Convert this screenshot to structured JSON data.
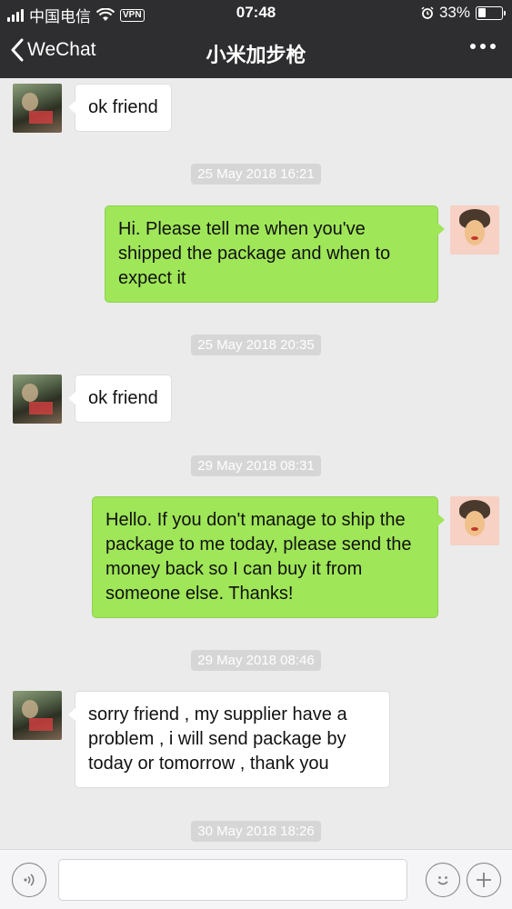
{
  "status": {
    "carrier": "中国电信",
    "vpn": "VPN",
    "time": "07:48",
    "battery_pct": "33%",
    "battery_level": 0.33
  },
  "nav": {
    "back_label": "WeChat",
    "title": "小米加步枪"
  },
  "messages": [
    {
      "sender": "friend",
      "text": "ok friend"
    },
    {
      "timestamp": "25 May 2018 16:21"
    },
    {
      "sender": "me",
      "text": "Hi. Please tell me when you've shipped the package and when to expect it"
    },
    {
      "timestamp": "25 May 2018 20:35"
    },
    {
      "sender": "friend",
      "text": "ok friend"
    },
    {
      "timestamp": "29 May 2018 08:31"
    },
    {
      "sender": "me",
      "text": "Hello. If you don't manage to ship the package to me today, please send the money back so I can buy it from someone else. Thanks!"
    },
    {
      "timestamp": "29 May 2018 08:46"
    },
    {
      "sender": "friend",
      "text": "sorry friend , my supplier have a problem , i will send package by today or tomorrow , thank you"
    },
    {
      "timestamp": "30 May 2018 18:26"
    }
  ],
  "input": {
    "value": ""
  },
  "colors": {
    "header_bg": "#2e2e30",
    "chat_bg": "#ebebeb",
    "my_bubble": "#9fe658",
    "friend_bubble": "#ffffff"
  },
  "icons": {
    "voice": "voice-icon",
    "emoji": "emoji-icon",
    "plus": "plus-icon",
    "more": "more-icon",
    "back": "chevron-left-icon"
  }
}
